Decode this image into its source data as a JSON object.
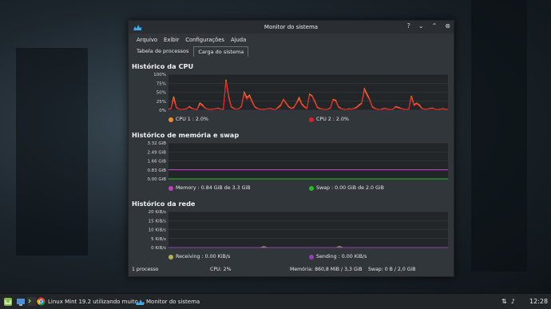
{
  "window": {
    "title": "Monitor do sistema",
    "menu": [
      "Arquivo",
      "Exibir",
      "Configurações",
      "Ajuda"
    ],
    "tabs": [
      "Tabela de processos",
      "Carga do sistema"
    ],
    "active_tab": 1
  },
  "cpu": {
    "title": "Histórico da CPU",
    "yticks": [
      "100%",
      "75%",
      "50%",
      "25%",
      "0%"
    ],
    "series": [
      {
        "name": "CPU 1 : 2.0%",
        "color": "#f28c28"
      },
      {
        "name": "CPU 2 : 2.0%",
        "color": "#e0202a"
      }
    ]
  },
  "memory": {
    "title": "Histórico de memória e swap",
    "yticks": [
      "3.32 GiB",
      "2.49 GiB",
      "1.66 GiB",
      "0.83 GiB",
      "0.00 GiB"
    ],
    "series": [
      {
        "name": "Memory : 0.84 GiB de 3.3 GiB",
        "color": "#c040c0"
      },
      {
        "name": "Swap : 0.00 GiB de 2.0 GiB",
        "color": "#20c020"
      }
    ]
  },
  "network": {
    "title": "Histórico da rede",
    "yticks": [
      "20 KiB/s",
      "15 KiB/s",
      "10 KiB/s",
      "5 KiB/s",
      "0 KiB/s"
    ],
    "series": [
      {
        "name": "Receiving : 0.00 KiB/s",
        "color": "#b8b04a"
      },
      {
        "name": "Sending : 0.00 KiB/s",
        "color": "#9040b0"
      }
    ]
  },
  "status": {
    "processes": "1 processo",
    "cpu": "CPU: 2%",
    "memory": "Memória: 860,8 MiB / 3,3 GiB",
    "swap": "Swap: 0 B / 2,0 GiB"
  },
  "taskbar": {
    "browser_task": "Linux Mint 19.2 utilizando muito ...",
    "monitor_task": "Monitor do sistema",
    "clock": "12:28"
  },
  "chart_data": [
    {
      "type": "line",
      "title": "Histórico da CPU",
      "ylim": [
        0,
        100
      ],
      "series": [
        {
          "name": "CPU 1 : 2.0%",
          "values": [
            3,
            5,
            38,
            8,
            3,
            2,
            3,
            4,
            10,
            5,
            3,
            2,
            20,
            15,
            6,
            3,
            2,
            3,
            4,
            6,
            3,
            2,
            85,
            40,
            10,
            5,
            3,
            4,
            12,
            50,
            35,
            42,
            25,
            10,
            5,
            3,
            2,
            3,
            4,
            5,
            3,
            2,
            8,
            15,
            30,
            20,
            10,
            5,
            8,
            20,
            35,
            18,
            10,
            5,
            45,
            40,
            25,
            8,
            5,
            3,
            2,
            3,
            6,
            30,
            28,
            10,
            5,
            3,
            2,
            4,
            3,
            5,
            8,
            15,
            20,
            60,
            45,
            30,
            10,
            5,
            3,
            2,
            4,
            5,
            3,
            2,
            3,
            10,
            8,
            5,
            3,
            2,
            3,
            40,
            15,
            20,
            15,
            5,
            3,
            3,
            5,
            6,
            3,
            2,
            3,
            4,
            3,
            2
          ]
        },
        {
          "name": "CPU 2 : 2.0%",
          "values": [
            2,
            4,
            30,
            6,
            3,
            2,
            3,
            5,
            8,
            4,
            3,
            2,
            15,
            12,
            5,
            3,
            2,
            3,
            4,
            5,
            3,
            2,
            80,
            35,
            8,
            4,
            3,
            4,
            10,
            45,
            30,
            38,
            22,
            8,
            4,
            3,
            2,
            3,
            4,
            4,
            3,
            2,
            6,
            12,
            28,
            18,
            8,
            4,
            6,
            18,
            30,
            15,
            8,
            4,
            42,
            38,
            22,
            6,
            4,
            3,
            2,
            3,
            5,
            28,
            25,
            8,
            4,
            3,
            2,
            3,
            3,
            4,
            6,
            12,
            18,
            55,
            40,
            28,
            8,
            4,
            3,
            2,
            3,
            4,
            3,
            2,
            3,
            8,
            6,
            4,
            3,
            2,
            3,
            35,
            12,
            18,
            12,
            4,
            3,
            3,
            4,
            5,
            3,
            2,
            3,
            3,
            3,
            2
          ]
        }
      ]
    },
    {
      "type": "line",
      "title": "Histórico de memória e swap",
      "ylim": [
        0,
        3.32
      ],
      "series": [
        {
          "name": "Memory : 0.84 GiB de 3.3 GiB",
          "values": [
            0.84,
            0.84,
            0.84,
            0.84,
            0.84,
            0.84,
            0.84,
            0.84,
            0.84,
            0.84
          ]
        },
        {
          "name": "Swap : 0.00 GiB de 2.0 GiB",
          "values": [
            0,
            0,
            0,
            0,
            0,
            0,
            0,
            0,
            0,
            0
          ]
        }
      ]
    },
    {
      "type": "line",
      "title": "Histórico da rede",
      "ylim": [
        0,
        20
      ],
      "series": [
        {
          "name": "Receiving : 0.00 KiB/s",
          "values": [
            0,
            0,
            0,
            0,
            0,
            0,
            0,
            0,
            0,
            0,
            0,
            0,
            0,
            0,
            0,
            0,
            0,
            0,
            0,
            0,
            0,
            0,
            0,
            0,
            0,
            0,
            0,
            0,
            0,
            0.5,
            0,
            0,
            0,
            0,
            0,
            0,
            0,
            0,
            0,
            0,
            0,
            0,
            0,
            0,
            0,
            0,
            0,
            0,
            0,
            0,
            0,
            0,
            0.6,
            0,
            0,
            0,
            0,
            0,
            0,
            0,
            0,
            0,
            0,
            0,
            0,
            0,
            0,
            0,
            0,
            0,
            0,
            0,
            0,
            0,
            0,
            0,
            0,
            0,
            0,
            0,
            0,
            0,
            0,
            0,
            0,
            0
          ]
        },
        {
          "name": "Sending : 0.00 KiB/s",
          "values": [
            0,
            0,
            0,
            0,
            0,
            0,
            0,
            0,
            0,
            0,
            0,
            0,
            0,
            0,
            0,
            0,
            0,
            0,
            0,
            0,
            0,
            0,
            0,
            0,
            0,
            0,
            0,
            0,
            0,
            0,
            0,
            0,
            0,
            0,
            0,
            0,
            0,
            0,
            0,
            0,
            0,
            0,
            0,
            0,
            0,
            0,
            0,
            0,
            0,
            0,
            0,
            0,
            0,
            0,
            0,
            0,
            0,
            0,
            0,
            0,
            0,
            0,
            0,
            0,
            0,
            0,
            0,
            0,
            0,
            0,
            0,
            0,
            0,
            0,
            0,
            0,
            0,
            0,
            0,
            0,
            0,
            0,
            0,
            0,
            0,
            0
          ]
        }
      ]
    }
  ]
}
